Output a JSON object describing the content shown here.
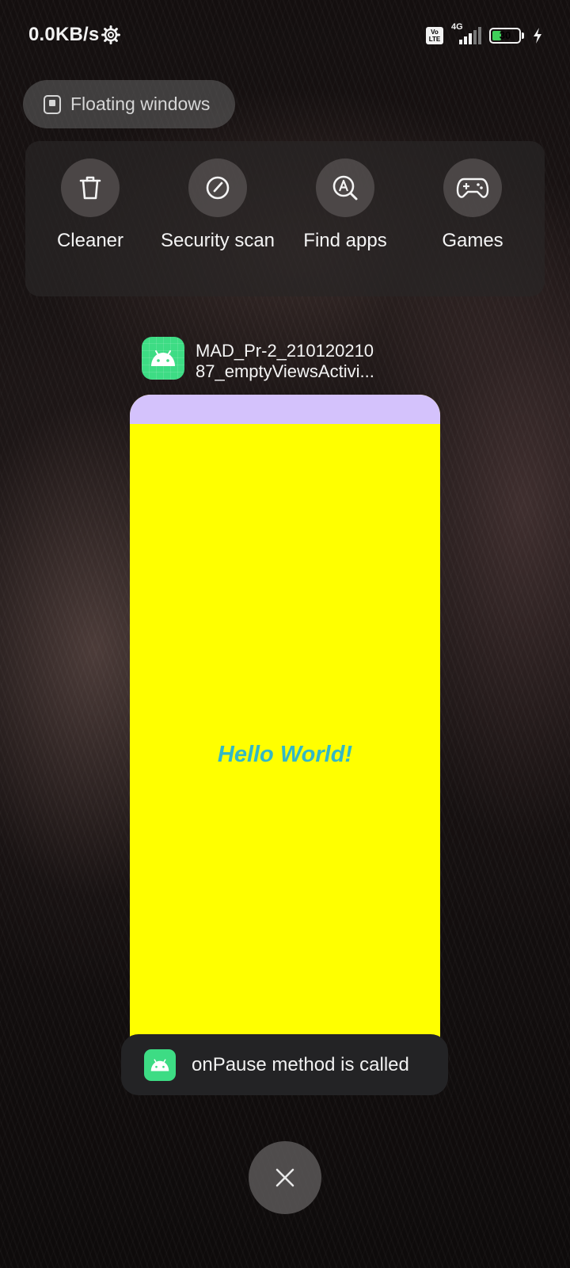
{
  "status_bar": {
    "net_speed": "0.0KB/s",
    "volte_label": "Vo LTE",
    "network_type": "4G",
    "battery_level": "30",
    "icons": [
      "gear-icon",
      "volte-icon",
      "signal-icon",
      "battery-icon",
      "charging-bolt-icon"
    ]
  },
  "floating_windows": {
    "label": "Floating windows",
    "icon": "floating-window-icon"
  },
  "quick_actions": [
    {
      "label": "Cleaner",
      "icon": "trash-icon"
    },
    {
      "label": "Security scan",
      "icon": "gauge-icon"
    },
    {
      "label": "Find apps",
      "icon": "find-apps-icon"
    },
    {
      "label": "Games",
      "icon": "gamepad-icon"
    }
  ],
  "recent_app": {
    "title_line1": "MAD_Pr-2_210120210",
    "title_line2": "87_emptyViewsActivi...",
    "icon": "android-icon",
    "preview": {
      "app_bar_color": "#d4c2fc",
      "background_color": "#ffff00",
      "text": "Hello World!",
      "text_color": "#33b8c4"
    }
  },
  "toast": {
    "message": "onPause method is called",
    "icon": "android-icon"
  },
  "close_all": {
    "icon": "close-icon"
  }
}
